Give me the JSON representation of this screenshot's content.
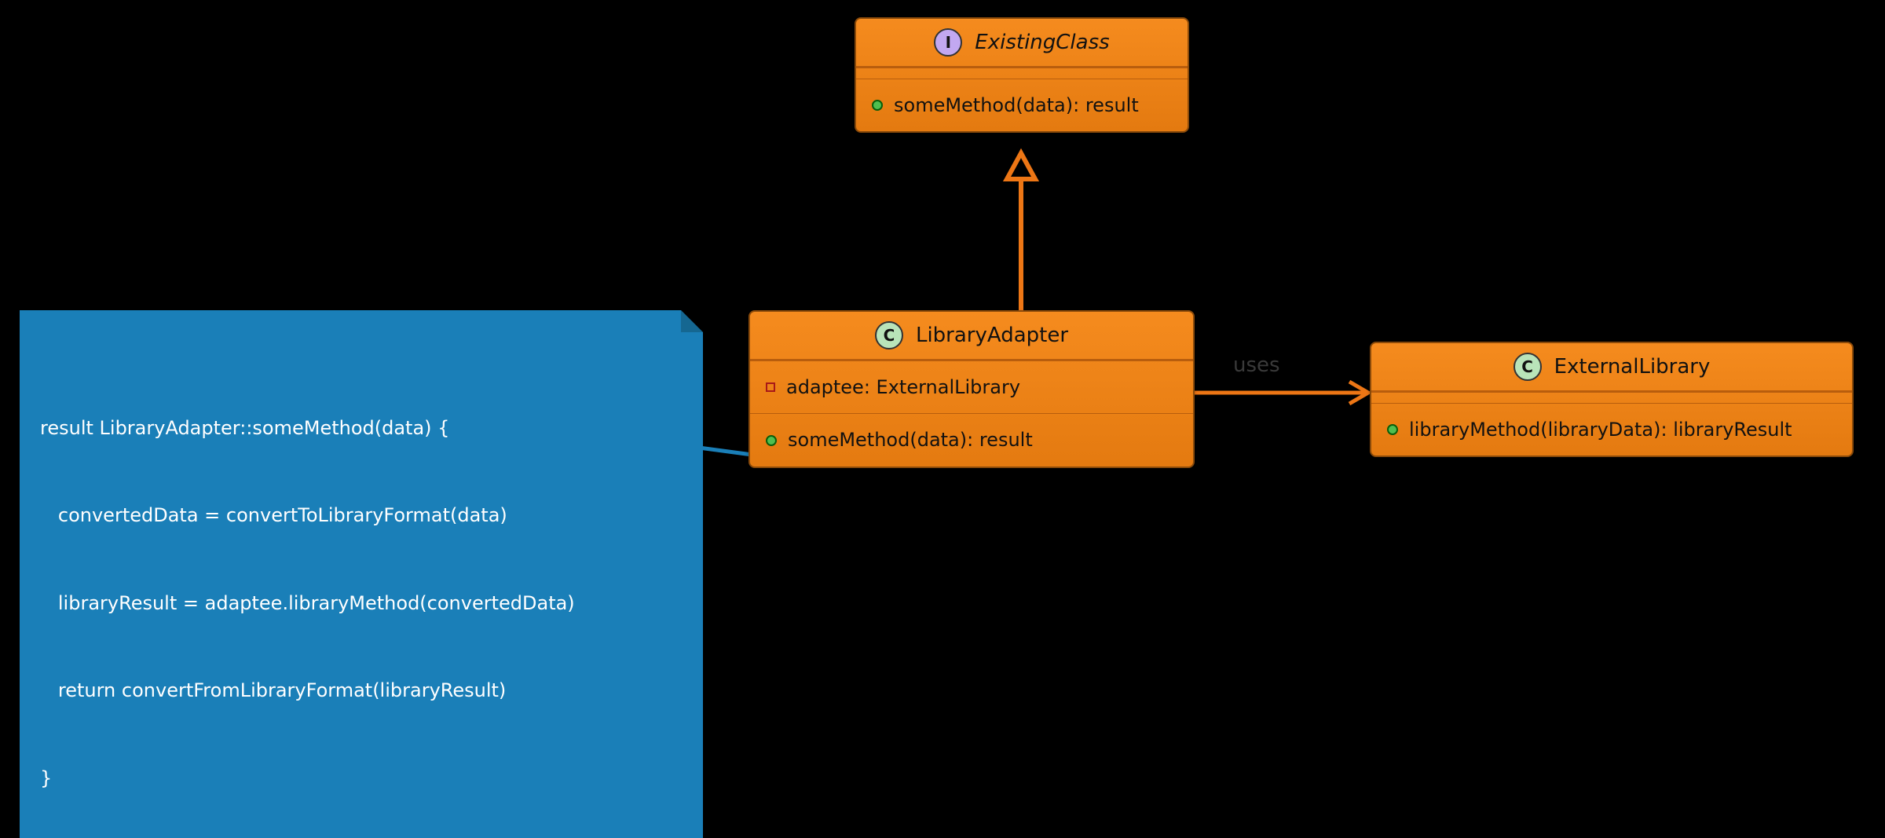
{
  "colors": {
    "box_fill": "#f58b1e",
    "box_border": "#8a4a0a",
    "note_fill": "#1a7fb8",
    "connector": "#ed7615"
  },
  "classes": {
    "existing": {
      "stereotype": "I",
      "name": "ExistingClass",
      "methods": [
        "someMethod(data): result"
      ]
    },
    "adapter": {
      "stereotype": "C",
      "name": "LibraryAdapter",
      "attributes": [
        "adaptee: ExternalLibrary"
      ],
      "methods": [
        "someMethod(data): result"
      ]
    },
    "external": {
      "stereotype": "C",
      "name": "ExternalLibrary",
      "methods": [
        "libraryMethod(libraryData): libraryResult"
      ]
    }
  },
  "note": {
    "lines": [
      "result LibraryAdapter::someMethod(data) {",
      "   convertedData = convertToLibraryFormat(data)",
      "   libraryResult = adaptee.libraryMethod(convertedData)",
      "   return convertFromLibraryFormat(libraryResult)",
      "}"
    ]
  },
  "edges": {
    "uses_label": "uses"
  }
}
